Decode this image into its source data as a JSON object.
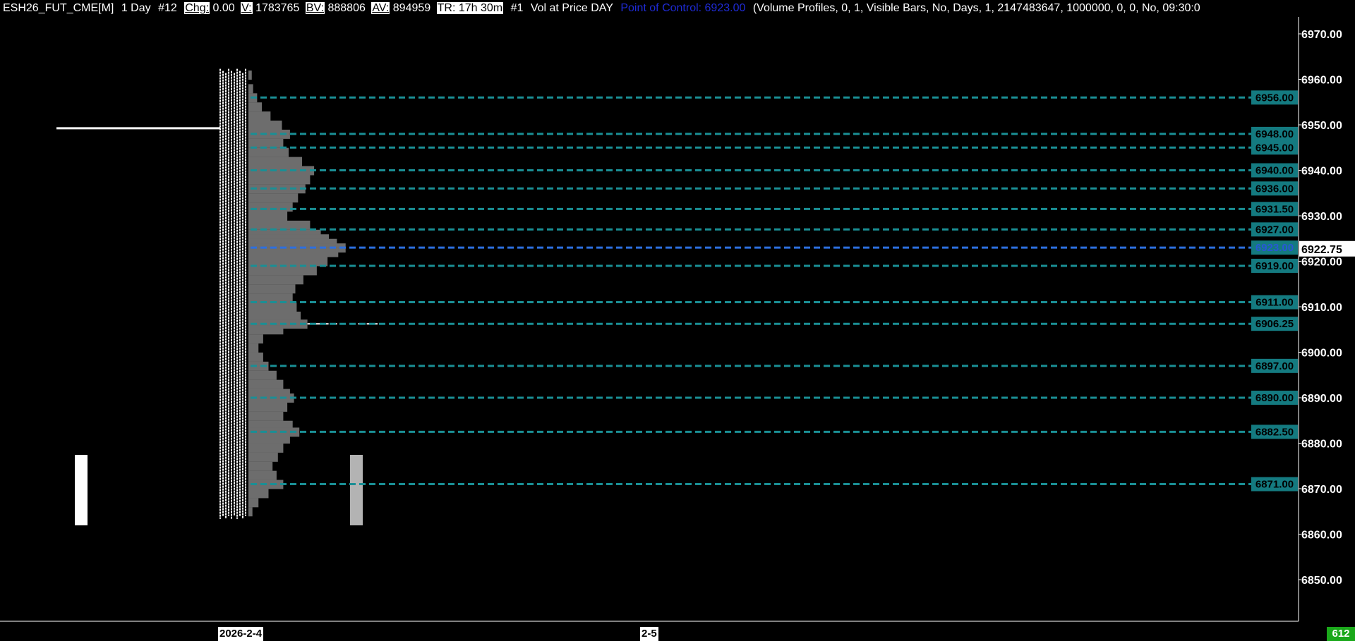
{
  "header": {
    "symbol": "ESH26_FUT_CME[M]",
    "timeframe": "1 Day",
    "chart_number": "#12",
    "chg_label": "Chg:",
    "chg_value": "0.00",
    "v_label": "V:",
    "v_value": "1783765",
    "bv_label": "BV:",
    "bv_value": "888806",
    "av_label": "AV:",
    "av_value": "894959",
    "tr_label": "TR: 17h 30m",
    "study_num": "#1",
    "study_name": "Vol at Price DAY",
    "poc_text": "Point of Control: 6923.00",
    "study_params": "(Volume Profiles, 0, 1, Visible Bars, No, Days, 1, 2147483647, 1000000, 0, 0, No, 09:30:0"
  },
  "colors": {
    "level_line": "#1a8f95",
    "level_label_bg": "#147a80",
    "poc_line": "#2d6fe0",
    "profile": "#6d6d6d"
  },
  "x_axis": {
    "date_1": "2026-2-4",
    "date_2": "2-5"
  },
  "status_badge": "612",
  "chart_data": {
    "type": "bar",
    "y_ticks": [
      "6970.00",
      "6960.00",
      "6950.00",
      "6940.00",
      "6930.00",
      "6920.00",
      "6910.00",
      "6900.00",
      "6890.00",
      "6880.00",
      "6870.00",
      "6860.00",
      "6850.00"
    ],
    "ylim": [
      6842,
      6976
    ],
    "levels": [
      {
        "price": 6956.0,
        "label": "6956.00"
      },
      {
        "price": 6948.0,
        "label": "6948.00"
      },
      {
        "price": 6945.0,
        "label": "6945.00"
      },
      {
        "price": 6940.0,
        "label": "6940.00"
      },
      {
        "price": 6936.0,
        "label": "6936.00"
      },
      {
        "price": 6931.5,
        "label": "6931.50"
      },
      {
        "price": 6927.0,
        "label": "6927.00"
      },
      {
        "price": 6923.0,
        "label": "6923.00",
        "poc": true
      },
      {
        "price": 6919.0,
        "label": "6919.00"
      },
      {
        "price": 6911.0,
        "label": "6911.00"
      },
      {
        "price": 6906.25,
        "label": "6906.25"
      },
      {
        "price": 6897.0,
        "label": "6897.00"
      },
      {
        "price": 6890.0,
        "label": "6890.00"
      },
      {
        "price": 6882.5,
        "label": "6882.50"
      },
      {
        "price": 6871.0,
        "label": "6871.00"
      }
    ],
    "current_price": {
      "price": 6922.75,
      "label": "6922.75"
    },
    "prior_close_line": {
      "price": 6949.25
    },
    "volume_bars": [
      {
        "value": 1.0,
        "color": "#ffffff"
      },
      {
        "value": 1.0,
        "color": "#b3b3b3"
      }
    ],
    "profile": [
      [
        6961,
        0.05
      ],
      [
        6958,
        0.07
      ],
      [
        6956,
        0.13
      ],
      [
        6954,
        0.2
      ],
      [
        6952,
        0.33
      ],
      [
        6950,
        0.5
      ],
      [
        6948,
        0.62
      ],
      [
        6946,
        0.52
      ],
      [
        6944,
        0.6
      ],
      [
        6942,
        0.8
      ],
      [
        6940,
        0.98
      ],
      [
        6938,
        0.92
      ],
      [
        6936,
        0.85
      ],
      [
        6934,
        0.74
      ],
      [
        6932,
        0.66
      ],
      [
        6930,
        0.58
      ],
      [
        6928,
        0.92
      ],
      [
        6926,
        1.08
      ],
      [
        6925,
        1.2
      ],
      [
        6924,
        1.32
      ],
      [
        6923,
        1.45
      ],
      [
        6922,
        1.34
      ],
      [
        6920,
        1.18
      ],
      [
        6918,
        1.02
      ],
      [
        6916,
        0.82
      ],
      [
        6914,
        0.7
      ],
      [
        6912,
        0.66
      ],
      [
        6910,
        0.72
      ],
      [
        6908,
        0.78
      ],
      [
        6906.25,
        0.88
      ],
      [
        6905,
        0.52
      ],
      [
        6903,
        0.22
      ],
      [
        6901,
        0.15
      ],
      [
        6899,
        0.22
      ],
      [
        6897,
        0.3
      ],
      [
        6895,
        0.42
      ],
      [
        6893,
        0.52
      ],
      [
        6891,
        0.62
      ],
      [
        6890,
        0.68
      ],
      [
        6888,
        0.58
      ],
      [
        6886,
        0.52
      ],
      [
        6884,
        0.66
      ],
      [
        6882.5,
        0.76
      ],
      [
        6881,
        0.62
      ],
      [
        6879,
        0.52
      ],
      [
        6877,
        0.44
      ],
      [
        6875,
        0.36
      ],
      [
        6873,
        0.42
      ],
      [
        6871,
        0.52
      ],
      [
        6869,
        0.3
      ],
      [
        6867,
        0.15
      ],
      [
        6865,
        0.06
      ]
    ],
    "profile_low": 6864,
    "profile_high": 6962
  }
}
